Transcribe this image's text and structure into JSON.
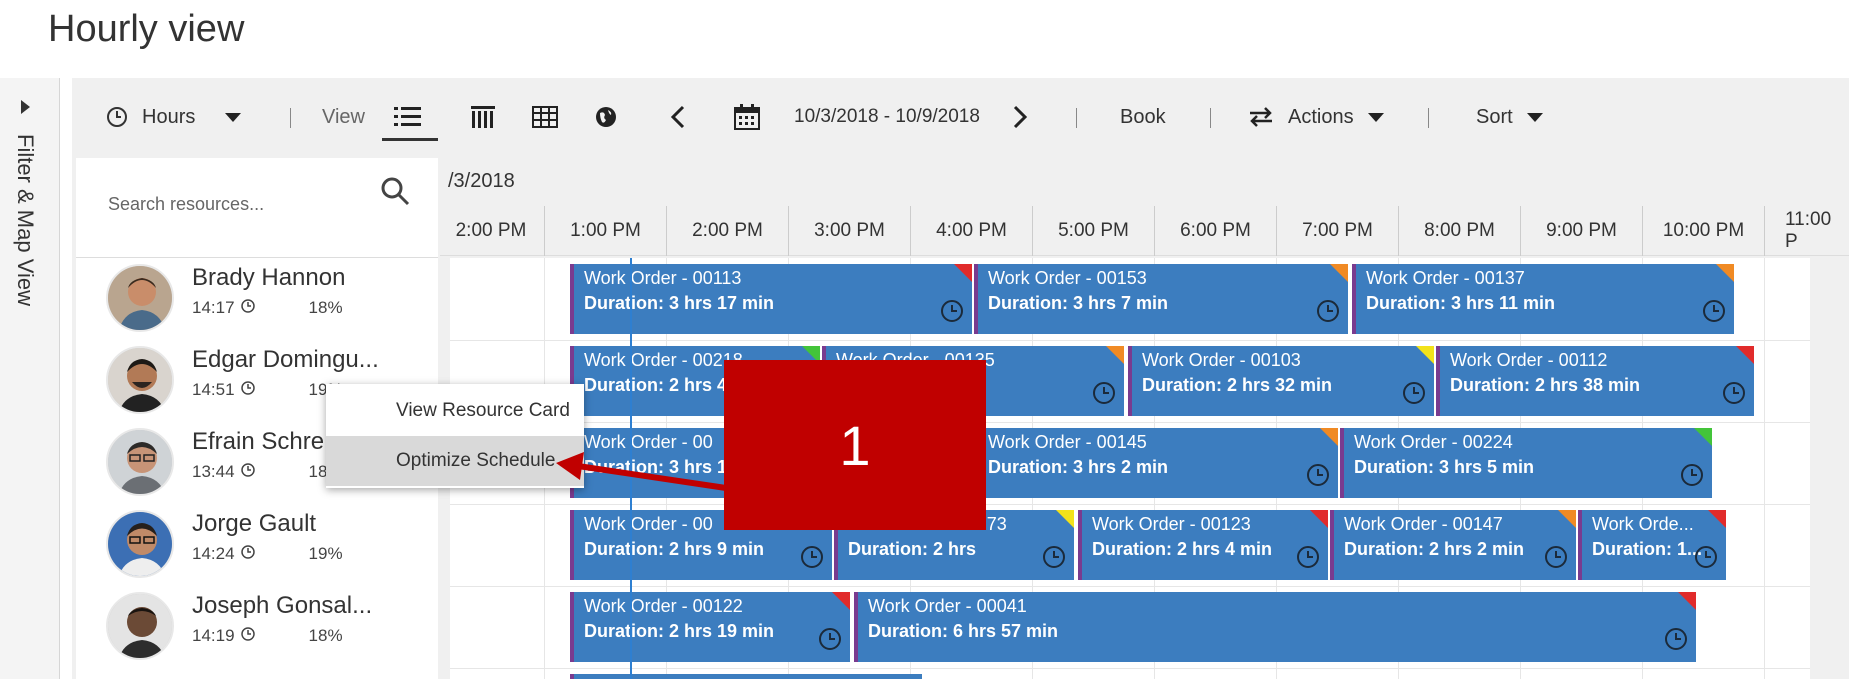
{
  "page": {
    "title": "Hourly view"
  },
  "filter_rail": {
    "label": "Filter & Map View"
  },
  "toolbar": {
    "hours_label": "Hours",
    "view_label": "View",
    "date_range": "10/3/2018 - 10/9/2018",
    "book_label": "Book",
    "actions_label": "Actions",
    "sort_label": "Sort"
  },
  "search": {
    "placeholder": "Search resources..."
  },
  "timeline": {
    "date": "/3/2018",
    "hours": [
      "2:00 PM",
      "1:00 PM",
      "2:00 PM",
      "3:00 PM",
      "4:00 PM",
      "5:00 PM",
      "6:00 PM",
      "7:00 PM",
      "8:00 PM",
      "9:00 PM",
      "10:00 PM",
      "11:00 P"
    ]
  },
  "resources": [
    {
      "name": "Brady Hannon",
      "time": "14:17",
      "percent": "18%"
    },
    {
      "name": "Edgar Domingu...",
      "time": "14:51",
      "percent": "19%"
    },
    {
      "name": "Efrain Schre",
      "time": "13:44",
      "percent": "18%"
    },
    {
      "name": "Jorge Gault",
      "time": "14:24",
      "percent": "19%"
    },
    {
      "name": "Joseph Gonsal...",
      "time": "14:19",
      "percent": "18%"
    }
  ],
  "bookings": {
    "row0": [
      {
        "title": "Work Order - 00113",
        "duration": "Duration: 3 hrs 17 min",
        "flag": "#e12b2b"
      },
      {
        "title": "Work Order - 00153",
        "duration": "Duration: 3 hrs 7 min",
        "flag": "#f08a24"
      },
      {
        "title": "Work Order - 00137",
        "duration": "Duration: 3 hrs 11 min",
        "flag": "#f08a24"
      }
    ],
    "row1": [
      {
        "title": "Work Order - 00218",
        "duration": "Duration: 2 hrs 4",
        "flag": "#43c43a"
      },
      {
        "title": "Work Order - 00135",
        "duration": "Duration: 0 min",
        "flag": "#f08a24"
      },
      {
        "title": "Work Order - 00103",
        "duration": "Duration: 2 hrs 32 min",
        "flag": "#f2e21a"
      },
      {
        "title": "Work Order - 00112",
        "duration": "Duration: 2 hrs 38 min",
        "flag": "#e12b2b"
      }
    ],
    "row2": [
      {
        "title": "Work Order - 00",
        "duration": "Duration: 3 hrs 1",
        "flag": "#e12b2b"
      },
      {
        "title": "Work Order - 00145",
        "duration": "Duration: 3 hrs 2 min",
        "flag": "#f08a24"
      },
      {
        "title": "Work Order - 00224",
        "duration": "Duration: 3 hrs 5 min",
        "flag": "#43c43a"
      }
    ],
    "row3": [
      {
        "title": "Work Order - 00",
        "duration": "Duration: 2 hrs 9 min",
        "flag": "#e12b2b"
      },
      {
        "title": "Work Order - 00173",
        "duration": "Duration: 2 hrs",
        "flag": "#f2e21a"
      },
      {
        "title": "Work Order - 00123",
        "duration": "Duration: 2 hrs 4 min",
        "flag": "#e12b2b"
      },
      {
        "title": "Work Order - 00147",
        "duration": "Duration: 2 hrs 2 min",
        "flag": "#f08a24"
      },
      {
        "title": "Work Orde...",
        "duration": "Duration: 1...",
        "flag": "#e12b2b"
      }
    ],
    "row4": [
      {
        "title": "Work Order - 00122",
        "duration": "Duration: 2 hrs 19 min",
        "flag": "#e12b2b"
      },
      {
        "title": "Work Order - 00041",
        "duration": "Duration: 6 hrs 57 min",
        "flag": "#e12b2b"
      }
    ]
  },
  "context_menu": {
    "view_resource_card": "View Resource Card",
    "optimize_schedule": "Optimize Schedule"
  },
  "callout": {
    "number": "1"
  },
  "colors": {
    "booking": "#3c7dbf",
    "callout": "#c00000",
    "now_line": "#2e7fd1"
  }
}
